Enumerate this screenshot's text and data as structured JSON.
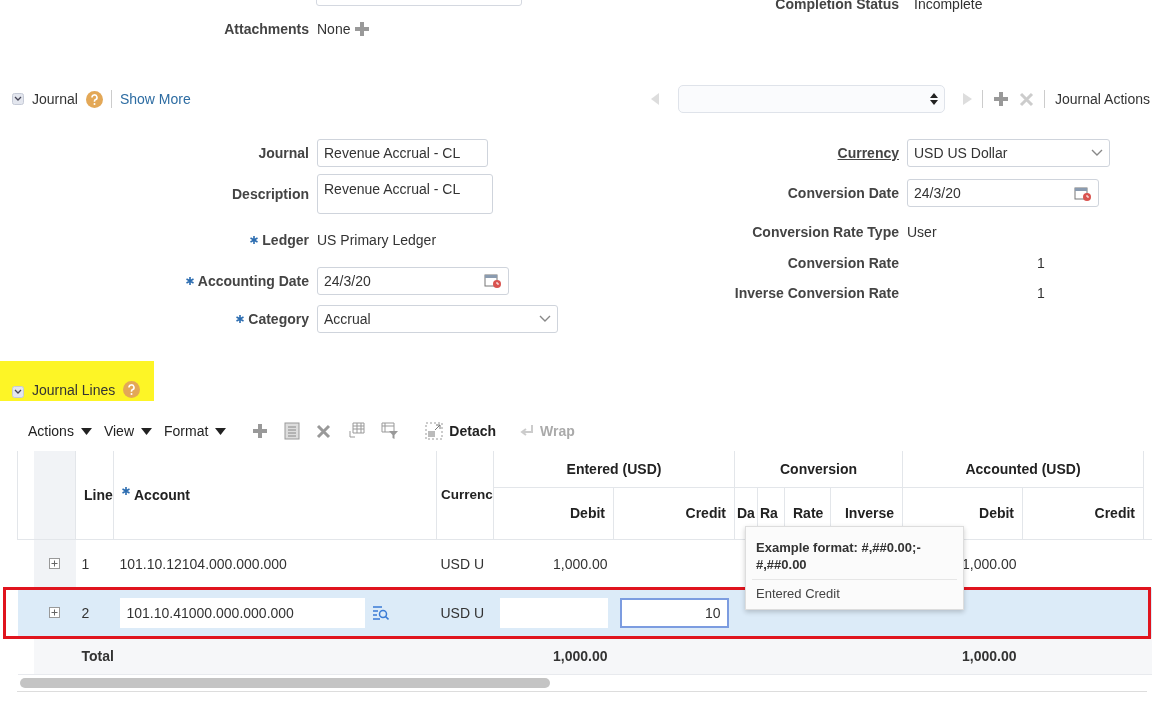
{
  "top": {
    "completion_label": "Completion Status",
    "completion_value": "Incomplete",
    "attachments_label": "Attachments",
    "attachments_value": "None"
  },
  "journal_section": {
    "title": "Journal",
    "expanded": true,
    "show_more": "Show More",
    "actions": "Journal Actions"
  },
  "journal_fields": [
    {
      "label": "Journal",
      "kind": "input",
      "value": "Revenue Accrual - CL",
      "required": false
    },
    {
      "label": "Description",
      "kind": "textarea",
      "value": "Revenue Accrual - CL",
      "required": false
    },
    {
      "label": "Ledger",
      "kind": "text",
      "value": "US Primary Ledger",
      "required": true
    },
    {
      "label": "Accounting Date",
      "kind": "date",
      "value": "24/3/20",
      "required": true
    },
    {
      "label": "Category",
      "kind": "select",
      "value": "Accrual",
      "required": true
    }
  ],
  "conversion_fields": [
    {
      "label": "Currency",
      "kind": "select",
      "value": "USD US Dollar",
      "link": true
    },
    {
      "label": "Conversion Date",
      "kind": "date",
      "value": "24/3/20",
      "link": false
    },
    {
      "label": "Conversion Rate Type",
      "kind": "text",
      "value": "User",
      "link": false
    },
    {
      "label": "Conversion Rate",
      "kind": "number",
      "value": "1",
      "link": false
    },
    {
      "label": "Inverse Conversion Rate",
      "kind": "number",
      "value": "1",
      "link": false
    }
  ],
  "lines_section": {
    "title": "Journal Lines",
    "expanded": true,
    "highlighted": true
  },
  "toolbar": {
    "menus": [
      "Actions",
      "View",
      "Format"
    ],
    "buttons": [
      {
        "label": "Detach",
        "disabled": false
      },
      {
        "label": "Wrap",
        "disabled": true
      }
    ]
  },
  "table": {
    "groups": [
      "Entered (USD)",
      "Conversion",
      "Accounted (USD)"
    ],
    "columns": {
      "line": "Line",
      "account": "Account",
      "currency": "Currenc",
      "entered_debit": "Debit",
      "entered_credit": "Credit",
      "da": "Da",
      "ra": "Ra",
      "rate": "Rate",
      "inverse": "Inverse",
      "accounted_debit": "Debit",
      "accounted_credit": "Credit"
    },
    "rows": [
      {
        "kind": "view",
        "line": "1",
        "account": "101.10.12104.000.000.000",
        "currency": "USD U",
        "entered_debit": "1,000.00",
        "accounted_debit": "1,000.00",
        "selected": false,
        "annotated": false
      },
      {
        "kind": "edit",
        "line": "2",
        "account": "101.10.41000.000.000.000",
        "currency": "USD U",
        "entered_credit": "10",
        "credit_focused": true,
        "selected": true,
        "annotated": true
      }
    ],
    "total": {
      "label": "Total",
      "entered_debit": "1,000.00",
      "accounted_debit": "1,000.00"
    }
  },
  "tooltip": {
    "title": "Example format: #,##0.00;-#,##0.00",
    "text": "Entered Credit"
  }
}
